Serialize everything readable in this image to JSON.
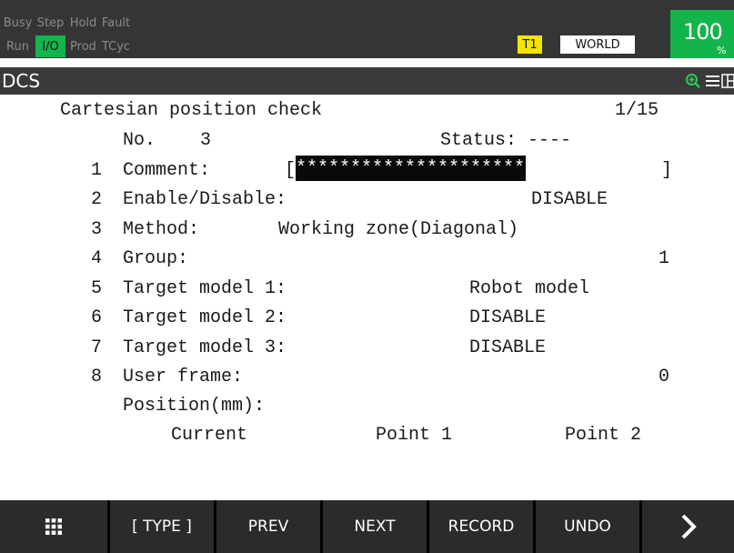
{
  "status_leds": {
    "busy": "Busy",
    "step": "Step",
    "hold": "Hold",
    "fault": "Fault",
    "run": "Run",
    "io": "I/O",
    "prod": "Prod",
    "tcyc": "TCyc"
  },
  "mode": {
    "t1": "T1",
    "world": "WORLD"
  },
  "override": {
    "value": "100",
    "unit": "%"
  },
  "title_bar": {
    "title": "DCS",
    "icons": [
      "zoom-in-icon",
      "menu-icon",
      "split-view-icon"
    ]
  },
  "screen": {
    "heading": "Cartesian position check",
    "page": "1/15",
    "no_label": "No.",
    "no_value": "3",
    "status_label": "Status:",
    "status_value": "----",
    "items": [
      {
        "num": "1",
        "label": "Comment:",
        "value": "*********************",
        "open": "[",
        "close": "]"
      },
      {
        "num": "2",
        "label": "Enable/Disable:",
        "value": "DISABLE"
      },
      {
        "num": "3",
        "label": "Method:",
        "value": "Working zone(Diagonal)"
      },
      {
        "num": "4",
        "label": "Group:",
        "value": "1"
      },
      {
        "num": "5",
        "label": "Target model 1:",
        "value": "Robot model"
      },
      {
        "num": "6",
        "label": "Target model 2:",
        "value": "DISABLE"
      },
      {
        "num": "7",
        "label": "Target model 3:",
        "value": "DISABLE"
      },
      {
        "num": "8",
        "label": "User frame:",
        "value": "0"
      }
    ],
    "position_label": "Position(mm):",
    "columns": [
      "Current",
      "Point 1",
      "Point 2"
    ]
  },
  "fkeys": {
    "grid": "grid-menu-icon",
    "type": "[ TYPE ]",
    "prev": "PREV",
    "next": "NEXT",
    "record": "RECORD",
    "undo": "UNDO",
    "more": "chevron-right-icon"
  },
  "colors": {
    "led_on": "#13b44b",
    "t1": "#f2e500",
    "highlight": "#0a0a0a"
  }
}
